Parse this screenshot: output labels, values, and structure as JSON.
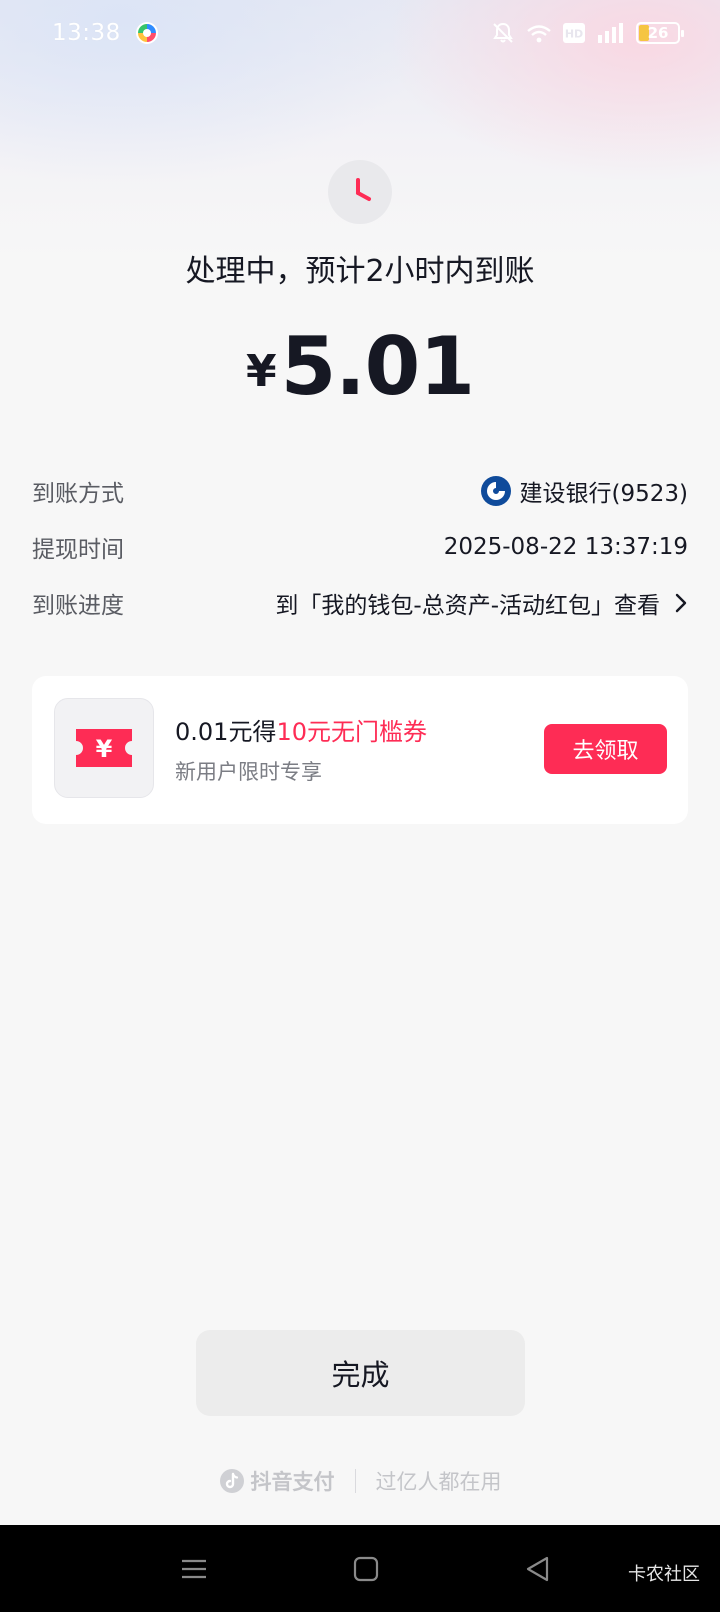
{
  "status_bar": {
    "time": "13:38",
    "network_label": "HD",
    "battery": "26",
    "battery_fraction": 0.26
  },
  "status": {
    "headline": "处理中，预计2小时内到账"
  },
  "amount": {
    "currency": "¥",
    "value": "5.01"
  },
  "details": [
    {
      "label": "到账方式",
      "value": "建设银行(9523)",
      "icon": "ccb-bank-icon"
    },
    {
      "label": "提现时间",
      "value": "2025-08-22 13:37:19"
    },
    {
      "label": "到账进度",
      "value": "到「我的钱包-总资产-活动红包」查看",
      "icon": "chevron-right-icon"
    }
  ],
  "promo": {
    "title_prefix": "0.01元得",
    "title_highlight": "10元无门槛券",
    "subtitle": "新用户限时专享",
    "button": "去领取",
    "icon_symbol": "¥"
  },
  "done_button": "完成",
  "footer": {
    "brand": "抖音支付",
    "slogan": "过亿人都在用"
  },
  "watermark": "卡农社区",
  "colors": {
    "accent": "#fe2c55",
    "text_primary": "#161823",
    "text_secondary": "#5a5c63"
  }
}
